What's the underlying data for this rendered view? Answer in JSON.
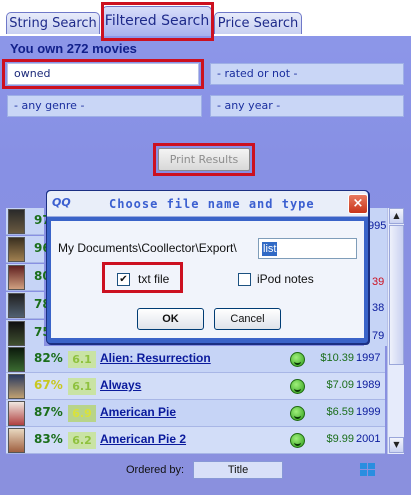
{
  "tabs": [
    {
      "label": "String Search"
    },
    {
      "label": "Filtered Search"
    },
    {
      "label": "Price Search"
    }
  ],
  "summary": "You own 272 movies",
  "filters": {
    "ownership": "owned",
    "rated": "- rated or not -",
    "genre": "- any genre -",
    "year": "- any year -"
  },
  "print_button": "Print Results",
  "background_rows": {
    "percents": [
      "97",
      "96",
      "80",
      "78",
      "75"
    ],
    "years_visible": [
      "995",
      "39",
      "38",
      "79"
    ]
  },
  "movies": [
    {
      "pct": "82%",
      "rating": "6.1",
      "title": "Alien: Resurrection",
      "price": "$10.39",
      "year": "1997",
      "pct_color": "green"
    },
    {
      "pct": "67%",
      "rating": "6.1",
      "title": "Always",
      "price": "$7.09",
      "year": "1989",
      "pct_color": "yellow"
    },
    {
      "pct": "87%",
      "rating": "6.9",
      "title": "American Pie",
      "price": "$6.59",
      "year": "1999",
      "pct_color": "green"
    },
    {
      "pct": "83%",
      "rating": "6.2",
      "title": "American Pie 2",
      "price": "$9.99",
      "year": "2001",
      "pct_color": "green"
    }
  ],
  "footer": {
    "order_label": "Ordered by:",
    "order_value": "Title"
  },
  "dialog": {
    "logo": "QQ",
    "title": "Choose file name and type",
    "close": "×",
    "path_label": "My Documents\\Coollector\\Export\\",
    "filename": "list",
    "txt_label": "txt file",
    "txt_checked": "✔",
    "ipod_label": "iPod notes",
    "ok": "OK",
    "cancel": "Cancel"
  },
  "colors": {
    "highlight": "#cc1020",
    "accent": "#3a63c8"
  }
}
